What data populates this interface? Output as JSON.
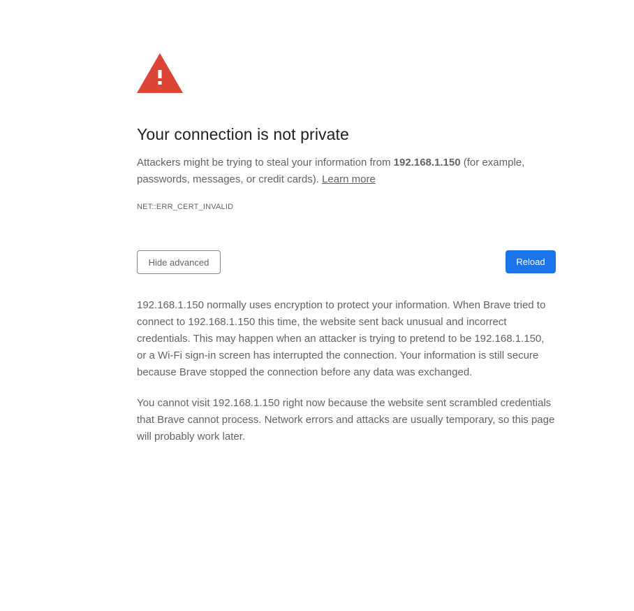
{
  "icon": {
    "name": "warning-triangle-icon",
    "color": "#db4437"
  },
  "heading": "Your connection is not private",
  "intro": {
    "before_host": "Attackers might be trying to steal your information from ",
    "host": "192.168.1.150",
    "after_host": " (for example, passwords, messages, or credit cards). ",
    "learn_more": "Learn more"
  },
  "error_code": "NET::ERR_CERT_INVALID",
  "buttons": {
    "hide_advanced": "Hide advanced",
    "reload": "Reload"
  },
  "colors": {
    "primary_button": "#1a73e8",
    "heading": "#202124",
    "body_text": "#5f6368"
  },
  "details": {
    "paragraph_1": "192.168.1.150 normally uses encryption to protect your information. When Brave tried to connect to 192.168.1.150 this time, the website sent back unusual and incorrect credentials. This may happen when an attacker is trying to pretend to be 192.168.1.150, or a Wi-Fi sign-in screen has interrupted the connection. Your information is still secure because Brave stopped the connection before any data was exchanged.",
    "paragraph_2": "You cannot visit 192.168.1.150 right now because the website sent scrambled credentials that Brave cannot process. Network errors and attacks are usually temporary, so this page will probably work later."
  }
}
